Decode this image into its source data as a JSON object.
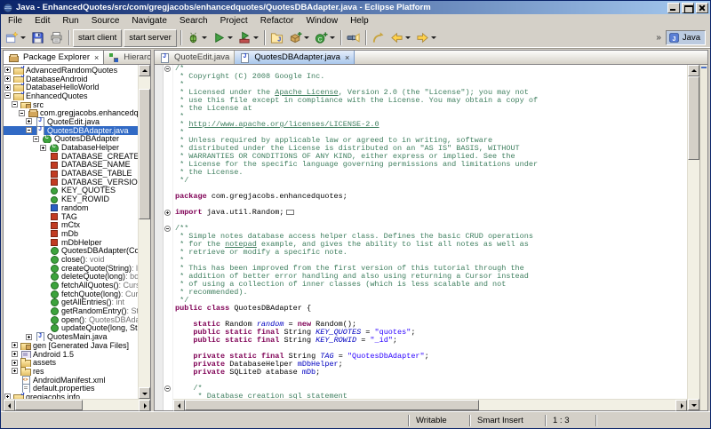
{
  "window": {
    "title": "Java - EnhancedQuotes/src/com/gregjacobs/enhancedquotes/QuotesDBAdapter.java - Eclipse Platform"
  },
  "colors": {
    "comment": "#3F7F5F",
    "keyword": "#7F0055",
    "string": "#2A00FF",
    "field": "#0000C0",
    "selection": "#316AC5",
    "titlebar_start": "#0A246A",
    "titlebar_end": "#A6CAF0"
  },
  "menubar": [
    "File",
    "Edit",
    "Run",
    "Source",
    "Navigate",
    "Search",
    "Project",
    "Refactor",
    "Window",
    "Help"
  ],
  "toolbar": {
    "perspective": "Java",
    "buttons": [
      {
        "name": "new-wizard",
        "icon": "new",
        "dropdown": true
      },
      {
        "name": "save",
        "icon": "save"
      },
      {
        "name": "print",
        "icon": "print"
      },
      {
        "sep": true
      },
      {
        "name": "start-client",
        "label": "start client"
      },
      {
        "name": "start-server",
        "label": "start server"
      },
      {
        "sep": true
      },
      {
        "name": "debug",
        "icon": "debug",
        "dropdown": true
      },
      {
        "name": "run",
        "icon": "run",
        "dropdown": true
      },
      {
        "name": "external-tools",
        "icon": "ext",
        "dropdown": true
      },
      {
        "sep": true
      },
      {
        "name": "new-java-project",
        "icon": "jproject"
      },
      {
        "name": "new-package",
        "icon": "package",
        "dropdown": true
      },
      {
        "name": "new-class",
        "icon": "class",
        "dropdown": true
      },
      {
        "sep": true
      },
      {
        "name": "search",
        "icon": "search"
      },
      {
        "sep": true
      },
      {
        "name": "last-edit-location",
        "icon": "lastedit"
      },
      {
        "name": "back",
        "icon": "back",
        "dropdown": true
      },
      {
        "name": "forward",
        "icon": "forward",
        "dropdown": true
      }
    ]
  },
  "explorer": {
    "tabs": [
      {
        "label": "Package Explorer",
        "icon": "pkgexp",
        "active": true
      },
      {
        "label": "Hierarchy",
        "icon": "hier",
        "active": false
      }
    ],
    "view_buttons": [
      "link-with-editor",
      "collapse-all",
      "view-menu"
    ],
    "tree": [
      {
        "label": "AdvancedRandomQuotes",
        "icon": "proj",
        "depth": 0,
        "twisty": "+"
      },
      {
        "label": "DatabaseAndroid",
        "icon": "proj",
        "depth": 0,
        "twisty": "+"
      },
      {
        "label": "DatabaseHelloWorld",
        "icon": "proj",
        "depth": 0,
        "twisty": "+"
      },
      {
        "label": "EnhancedQuotes",
        "icon": "proj",
        "depth": 0,
        "twisty": "-"
      },
      {
        "label": "src",
        "icon": "src",
        "depth": 1,
        "twisty": "-"
      },
      {
        "label": "com.gregjacobs.enhancedquotes",
        "icon": "pkg",
        "depth": 2,
        "twisty": "-"
      },
      {
        "label": "QuoteEdit.java",
        "icon": "jfile",
        "depth": 3,
        "twisty": "+"
      },
      {
        "label": "QuotesDBAdapter.java",
        "icon": "jfile",
        "depth": 3,
        "twisty": "-",
        "selected": true
      },
      {
        "label": "QuotesDBAdapter",
        "icon": "class",
        "depth": 4,
        "twisty": "-"
      },
      {
        "label": "DatabaseHelper",
        "icon": "class",
        "depth": 5,
        "twisty": "+"
      },
      {
        "label": "DATABASE_CREATE",
        "icon": "fpri",
        "depth": 5
      },
      {
        "label": "DATABASE_NAME",
        "icon": "fpri",
        "depth": 5
      },
      {
        "label": "DATABASE_TABLE",
        "icon": "fpri",
        "depth": 5
      },
      {
        "label": "DATABASE_VERSION",
        "icon": "fpri",
        "depth": 5
      },
      {
        "label": "KEY_QUOTES",
        "icon": "fpub",
        "depth": 5
      },
      {
        "label": "KEY_ROWID",
        "icon": "fpub",
        "depth": 5
      },
      {
        "label": "random",
        "icon": "fdef",
        "depth": 5
      },
      {
        "label": "TAG",
        "icon": "fpri",
        "depth": 5
      },
      {
        "label": "mCtx",
        "icon": "fpri",
        "depth": 5
      },
      {
        "label": "mDb",
        "icon": "fpri",
        "depth": 5
      },
      {
        "label": "mDbHelper",
        "icon": "fpri",
        "depth": 5
      },
      {
        "label": "QuotesDBAdapter(Context)",
        "icon": "mpub",
        "depth": 5
      },
      {
        "label": "close()",
        "suffix": " : void",
        "icon": "mpub",
        "depth": 5
      },
      {
        "label": "createQuote(String)",
        "suffix": " : long",
        "icon": "mpub",
        "depth": 5
      },
      {
        "label": "deleteQuote(long)",
        "suffix": " : boolea",
        "icon": "mpub",
        "depth": 5
      },
      {
        "label": "fetchAllQuotes()",
        "suffix": " : Cursor",
        "icon": "mpub",
        "depth": 5
      },
      {
        "label": "fetchQuote(long)",
        "suffix": " : Cursor",
        "icon": "mpub",
        "depth": 5
      },
      {
        "label": "getAllEntries()",
        "suffix": " : int",
        "icon": "mpub",
        "depth": 5
      },
      {
        "label": "getRandomEntry()",
        "suffix": " : String",
        "icon": "mpub",
        "depth": 5
      },
      {
        "label": "open()",
        "suffix": " : QuotesDBAdapter",
        "icon": "mpub",
        "depth": 5
      },
      {
        "label": "updateQuote(long, String)",
        "icon": "mpub",
        "depth": 5
      },
      {
        "label": "QuotesMain.java",
        "icon": "jfile",
        "depth": 3,
        "twisty": "+"
      },
      {
        "label": "gen [Generated Java Files]",
        "icon": "src",
        "depth": 1,
        "twisty": "+"
      },
      {
        "label": "Android 1.5",
        "icon": "lib",
        "depth": 1,
        "twisty": "+"
      },
      {
        "label": "assets",
        "icon": "folder",
        "depth": 1,
        "twisty": "+"
      },
      {
        "label": "res",
        "icon": "folder",
        "depth": 1,
        "twisty": "+"
      },
      {
        "label": "AndroidManifest.xml",
        "icon": "xml",
        "depth": 1
      },
      {
        "label": "default.properties",
        "icon": "file",
        "depth": 1
      },
      {
        "label": "gregjacobs.info",
        "icon": "proj",
        "depth": 0,
        "twisty": "+"
      }
    ]
  },
  "editor": {
    "tabs": [
      {
        "label": "QuoteEdit.java",
        "icon": "jfile",
        "active": false
      },
      {
        "label": "QuotesDBAdapter.java",
        "icon": "jfile",
        "active": true
      }
    ],
    "lines": [
      {
        "fold": "minus",
        "segments": [
          [
            "comment",
            "/*"
          ]
        ]
      },
      {
        "segments": [
          [
            "comment",
            " * Copyright (C) 2008 Google Inc."
          ]
        ]
      },
      {
        "segments": [
          [
            "comment",
            " *"
          ]
        ]
      },
      {
        "segments": [
          [
            "comment",
            " * Licensed under the "
          ],
          [
            "comment-link",
            "Apache License"
          ],
          [
            "comment",
            ", Version 2.0 (the \"License\"); you may not"
          ]
        ]
      },
      {
        "segments": [
          [
            "comment",
            " * use this file except in compliance with the License. You may obtain a copy of"
          ]
        ]
      },
      {
        "segments": [
          [
            "comment",
            " * the License at"
          ]
        ]
      },
      {
        "segments": [
          [
            "comment",
            " *"
          ]
        ]
      },
      {
        "segments": [
          [
            "comment",
            " * "
          ],
          [
            "comment-link",
            "http://www.apache.org/licenses/LICENSE-2.0"
          ]
        ]
      },
      {
        "segments": [
          [
            "comment",
            " *"
          ]
        ]
      },
      {
        "segments": [
          [
            "comment",
            " * Unless required by applicable law or agreed to in writing, software"
          ]
        ]
      },
      {
        "segments": [
          [
            "comment",
            " * distributed under the License is distributed on an \"AS IS\" BASIS, WITHOUT"
          ]
        ]
      },
      {
        "segments": [
          [
            "comment",
            " * WARRANTIES OR CONDITIONS OF ANY KIND, either express or implied. See the"
          ]
        ]
      },
      {
        "segments": [
          [
            "comment",
            " * License for the specific language governing permissions and limitations under"
          ]
        ]
      },
      {
        "segments": [
          [
            "comment",
            " * the License."
          ]
        ]
      },
      {
        "segments": [
          [
            "comment",
            " */"
          ]
        ]
      },
      {
        "segments": []
      },
      {
        "segments": [
          [
            "keyword",
            "package"
          ],
          [
            "plain",
            " com.gregjacobs.enhancedquotes;"
          ]
        ]
      },
      {
        "segments": []
      },
      {
        "fold": "plus",
        "segments": [
          [
            "keyword",
            "import"
          ],
          [
            "plain",
            " java.util.Random;"
          ],
          [
            "folded-region",
            ""
          ]
        ]
      },
      {
        "segments": []
      },
      {
        "fold": "minus",
        "segments": [
          [
            "comment",
            "/**"
          ]
        ]
      },
      {
        "segments": [
          [
            "comment",
            " * Simple notes database access helper class. Defines the basic CRUD operations"
          ]
        ]
      },
      {
        "segments": [
          [
            "comment",
            " * for the "
          ],
          [
            "comment-link",
            "notepad"
          ],
          [
            "comment",
            " example, and gives the ability to list all notes as well as"
          ]
        ]
      },
      {
        "segments": [
          [
            "comment",
            " * retrieve or modify a specific note."
          ]
        ]
      },
      {
        "segments": [
          [
            "comment",
            " *"
          ]
        ]
      },
      {
        "segments": [
          [
            "comment",
            " * This has been improved from the first version of this tutorial through the"
          ]
        ]
      },
      {
        "segments": [
          [
            "comment",
            " * addition of better error handling and also using returning a Cursor instead"
          ]
        ]
      },
      {
        "segments": [
          [
            "comment",
            " * of using a collection of inner classes (which is less scalable and not"
          ]
        ]
      },
      {
        "segments": [
          [
            "comment",
            " * recommended)."
          ]
        ]
      },
      {
        "segments": [
          [
            "comment",
            " */"
          ]
        ]
      },
      {
        "segments": [
          [
            "keyword",
            "public"
          ],
          [
            "plain",
            " "
          ],
          [
            "keyword",
            "class"
          ],
          [
            "plain",
            " QuotesDBAdapter {"
          ]
        ]
      },
      {
        "segments": []
      },
      {
        "segments": [
          [
            "plain",
            "    "
          ],
          [
            "keyword",
            "static"
          ],
          [
            "plain",
            " Random "
          ],
          [
            "static-field",
            "random"
          ],
          [
            "plain",
            " = "
          ],
          [
            "keyword",
            "new"
          ],
          [
            "plain",
            " Random();"
          ]
        ]
      },
      {
        "segments": [
          [
            "plain",
            "    "
          ],
          [
            "keyword",
            "public"
          ],
          [
            "plain",
            " "
          ],
          [
            "keyword",
            "static"
          ],
          [
            "plain",
            " "
          ],
          [
            "keyword",
            "final"
          ],
          [
            "plain",
            " String "
          ],
          [
            "static-field",
            "KEY_QUOTES"
          ],
          [
            "plain",
            " = "
          ],
          [
            "string",
            "\"quotes\""
          ],
          [
            "plain",
            ";"
          ]
        ]
      },
      {
        "segments": [
          [
            "plain",
            "    "
          ],
          [
            "keyword",
            "public"
          ],
          [
            "plain",
            " "
          ],
          [
            "keyword",
            "static"
          ],
          [
            "plain",
            " "
          ],
          [
            "keyword",
            "final"
          ],
          [
            "plain",
            " String "
          ],
          [
            "static-field",
            "KEY_ROWID"
          ],
          [
            "plain",
            " = "
          ],
          [
            "string",
            "\"_id\""
          ],
          [
            "plain",
            ";"
          ]
        ]
      },
      {
        "segments": []
      },
      {
        "segments": [
          [
            "plain",
            "    "
          ],
          [
            "keyword",
            "private"
          ],
          [
            "plain",
            " "
          ],
          [
            "keyword",
            "static"
          ],
          [
            "plain",
            " "
          ],
          [
            "keyword",
            "final"
          ],
          [
            "plain",
            " String "
          ],
          [
            "static-field",
            "TAG"
          ],
          [
            "plain",
            " = "
          ],
          [
            "string",
            "\"QuotesDbAdapter\""
          ],
          [
            "plain",
            ";"
          ]
        ]
      },
      {
        "segments": [
          [
            "plain",
            "    "
          ],
          [
            "keyword",
            "private"
          ],
          [
            "plain",
            " DatabaseHelper "
          ],
          [
            "field",
            "mDbHelper"
          ],
          [
            "plain",
            ";"
          ]
        ]
      },
      {
        "segments": [
          [
            "plain",
            "    "
          ],
          [
            "keyword",
            "private"
          ],
          [
            "plain",
            " SQLiteD atabase "
          ],
          [
            "field",
            "mDb"
          ],
          [
            "plain",
            ";"
          ]
        ]
      },
      {
        "segments": []
      },
      {
        "fold": "minus",
        "segments": [
          [
            "plain",
            "    "
          ],
          [
            "comment",
            "/*"
          ]
        ]
      },
      {
        "segments": [
          [
            "plain",
            "     "
          ],
          [
            "comment",
            "* Database creation "
          ],
          [
            "comment-link",
            "sql"
          ],
          [
            "comment",
            " statement"
          ]
        ]
      }
    ]
  },
  "statusbar": {
    "writable": "Writable",
    "insert_mode": "Smart Insert",
    "position": "1 : 3"
  }
}
